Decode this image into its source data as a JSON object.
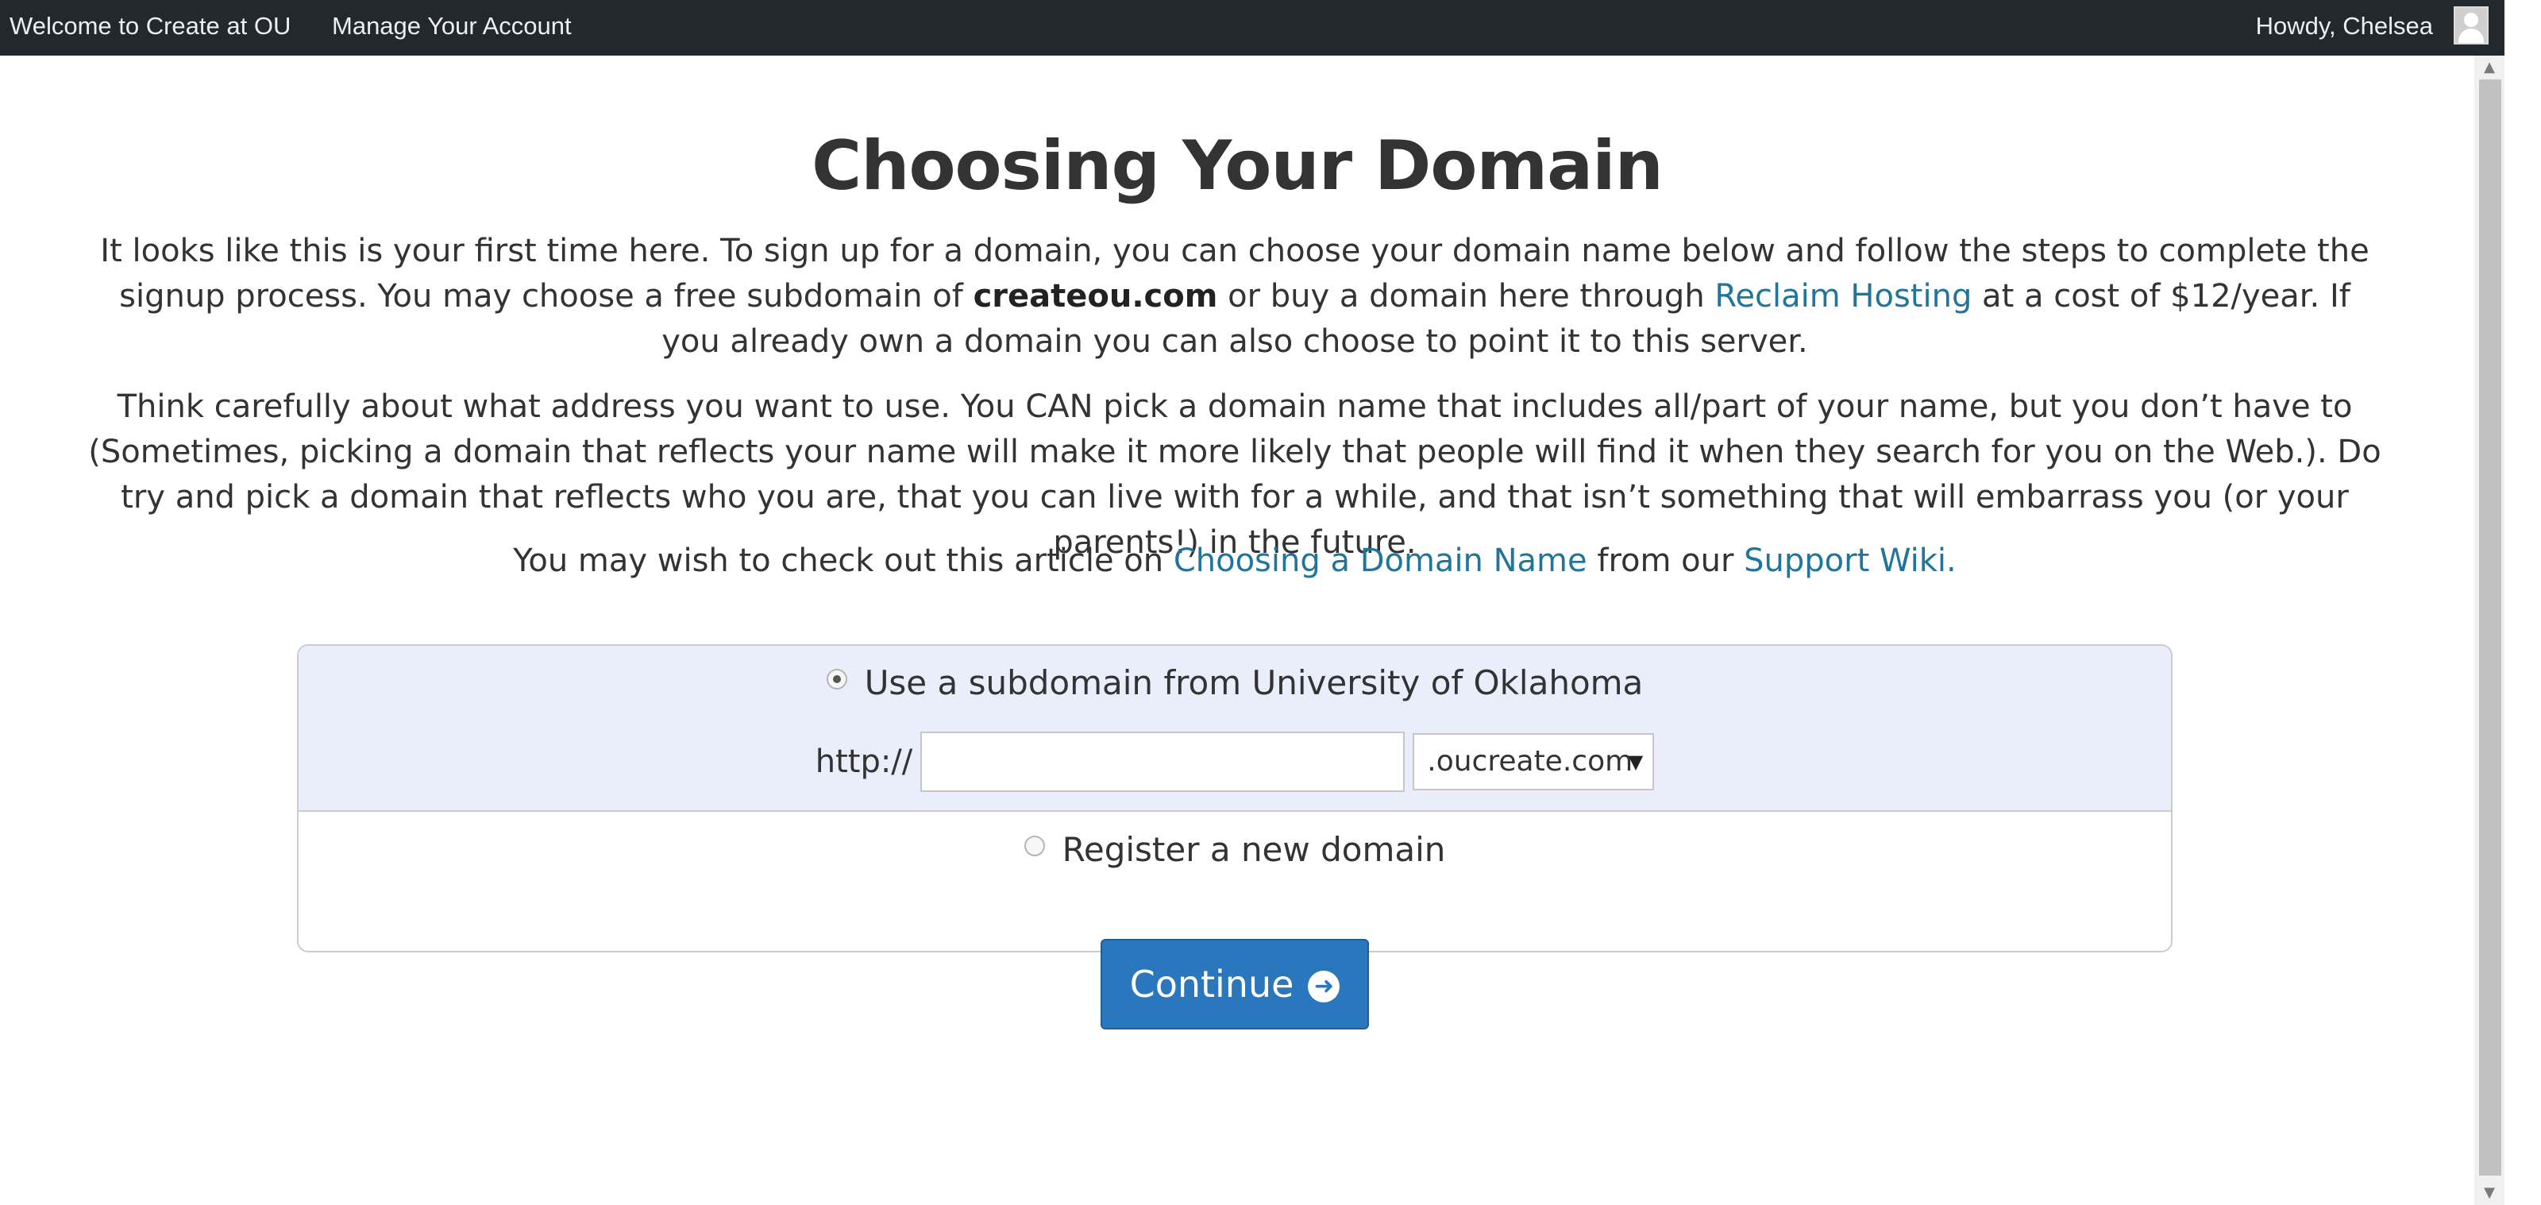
{
  "topbar": {
    "site_name": "Welcome to Create at OU",
    "account_link": "Manage Your Account",
    "greeting": "Howdy, Chelsea"
  },
  "page": {
    "title": "Choosing Your Domain",
    "intro": {
      "part1": "It looks like this is your first time here. To sign up for a domain, you can choose your domain name below and follow the steps to complete the signup process. You may choose a free subdomain of ",
      "bold_domain": "createou.com",
      "part2": " or buy a domain here through ",
      "reclaim_link": "Reclaim Hosting",
      "part3": " at a cost of $12/year. If you already own a domain you can also choose to point it to this server."
    },
    "advice": "Think carefully about what address you want to use. You CAN pick a domain name that includes all/part of your name, but you don’t have to (Sometimes, picking a domain that reflects your name will make it more likely that people will find it when they search for you on the Web.). Do try and pick a domain that reflects who you are, that you can live with for a while, and that isn’t something that will embarrass you (or your parents!) in the future.",
    "article": {
      "part1": "You may wish to check out this article on ",
      "article_link": "Choosing a Domain Name",
      "part2": " from our ",
      "wiki_link": "Support Wiki."
    }
  },
  "domain_form": {
    "subdomain_option": {
      "label": "Use a subdomain from University of Oklahoma",
      "selected": true
    },
    "url_prefix": "http://",
    "subdomain_input_value": "",
    "suffix_select": ".oucreate.com",
    "register_option": {
      "label": "Register a new domain",
      "selected": false
    }
  },
  "continue_button": {
    "label": "Continue"
  },
  "colors": {
    "topbar": "#23282d",
    "link": "#21759b",
    "button": "#2b77bd",
    "option_bg": "#eaeefb"
  },
  "icons": [
    "user-avatar-icon",
    "arrow-circle-right-icon",
    "scroll-up-icon",
    "scroll-down-icon"
  ]
}
